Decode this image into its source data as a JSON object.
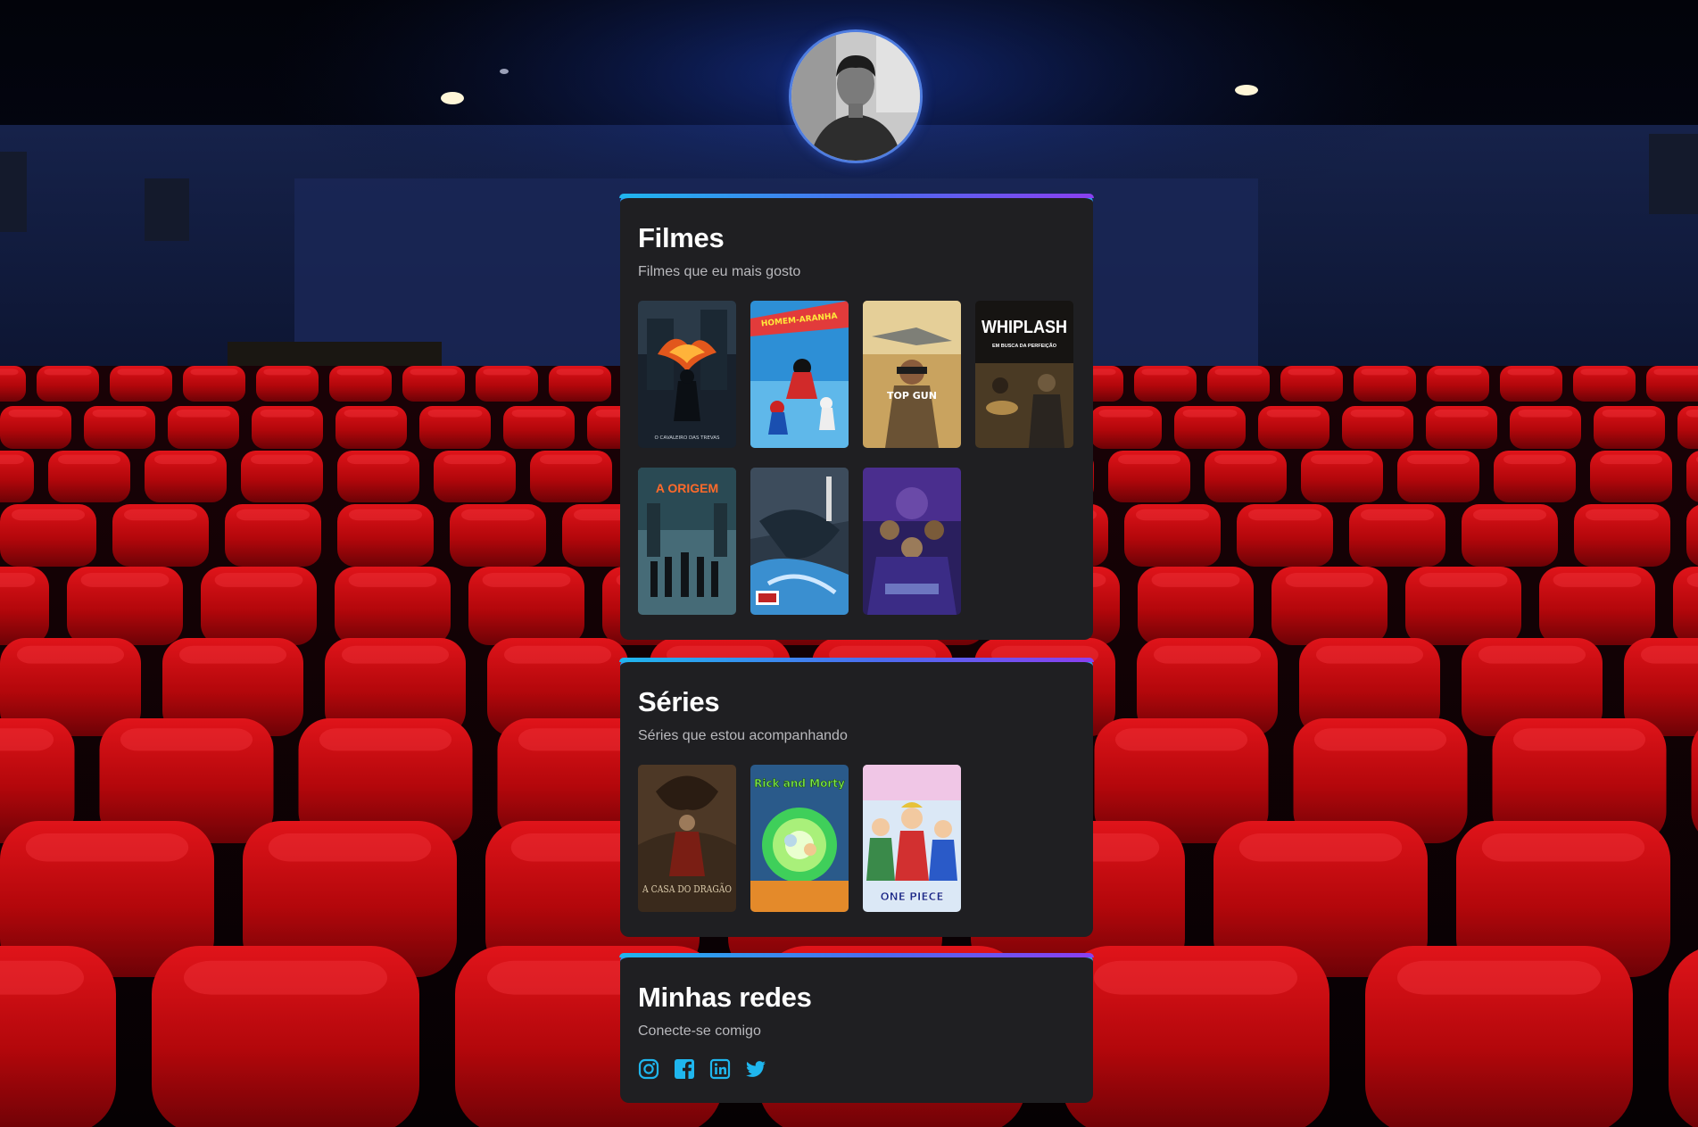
{
  "filmes": {
    "title": "Filmes",
    "subtitle": "Filmes que eu mais gosto",
    "posters": [
      {
        "icon": "dark-knight-poster",
        "text": "O CAVALEIRO DAS TREVAS"
      },
      {
        "icon": "spider-verse-poster",
        "text": "HOMEM-ARANHA"
      },
      {
        "icon": "top-gun-poster",
        "text": "TOP GUN"
      },
      {
        "icon": "whiplash-poster",
        "text": "WHIPLASH",
        "sub": "EM BUSCA DA PERFEIÇÃO"
      },
      {
        "icon": "inception-poster",
        "text": "A ORIGEM"
      },
      {
        "icon": "demon-slayer-poster",
        "text": ""
      },
      {
        "icon": "avengers-poster",
        "text": ""
      }
    ]
  },
  "series": {
    "title": "Séries",
    "subtitle": "Séries que estou acompanhando",
    "posters": [
      {
        "icon": "house-of-dragon-poster",
        "text": "A CASA DO DRAGÃO"
      },
      {
        "icon": "rick-and-morty-poster",
        "text": "Rick and Morty"
      },
      {
        "icon": "one-piece-poster",
        "text": "ONE PIECE"
      }
    ]
  },
  "redes": {
    "title": "Minhas redes",
    "subtitle": "Conecte-se comigo",
    "links": [
      "instagram-icon",
      "facebook-icon",
      "linkedin-icon",
      "twitter-icon"
    ]
  },
  "colors": {
    "accent": "#1fb6ee",
    "accent_end": "#8a3ff0",
    "card_bg": "#1f1f22",
    "seat_red": "#c4090b"
  }
}
